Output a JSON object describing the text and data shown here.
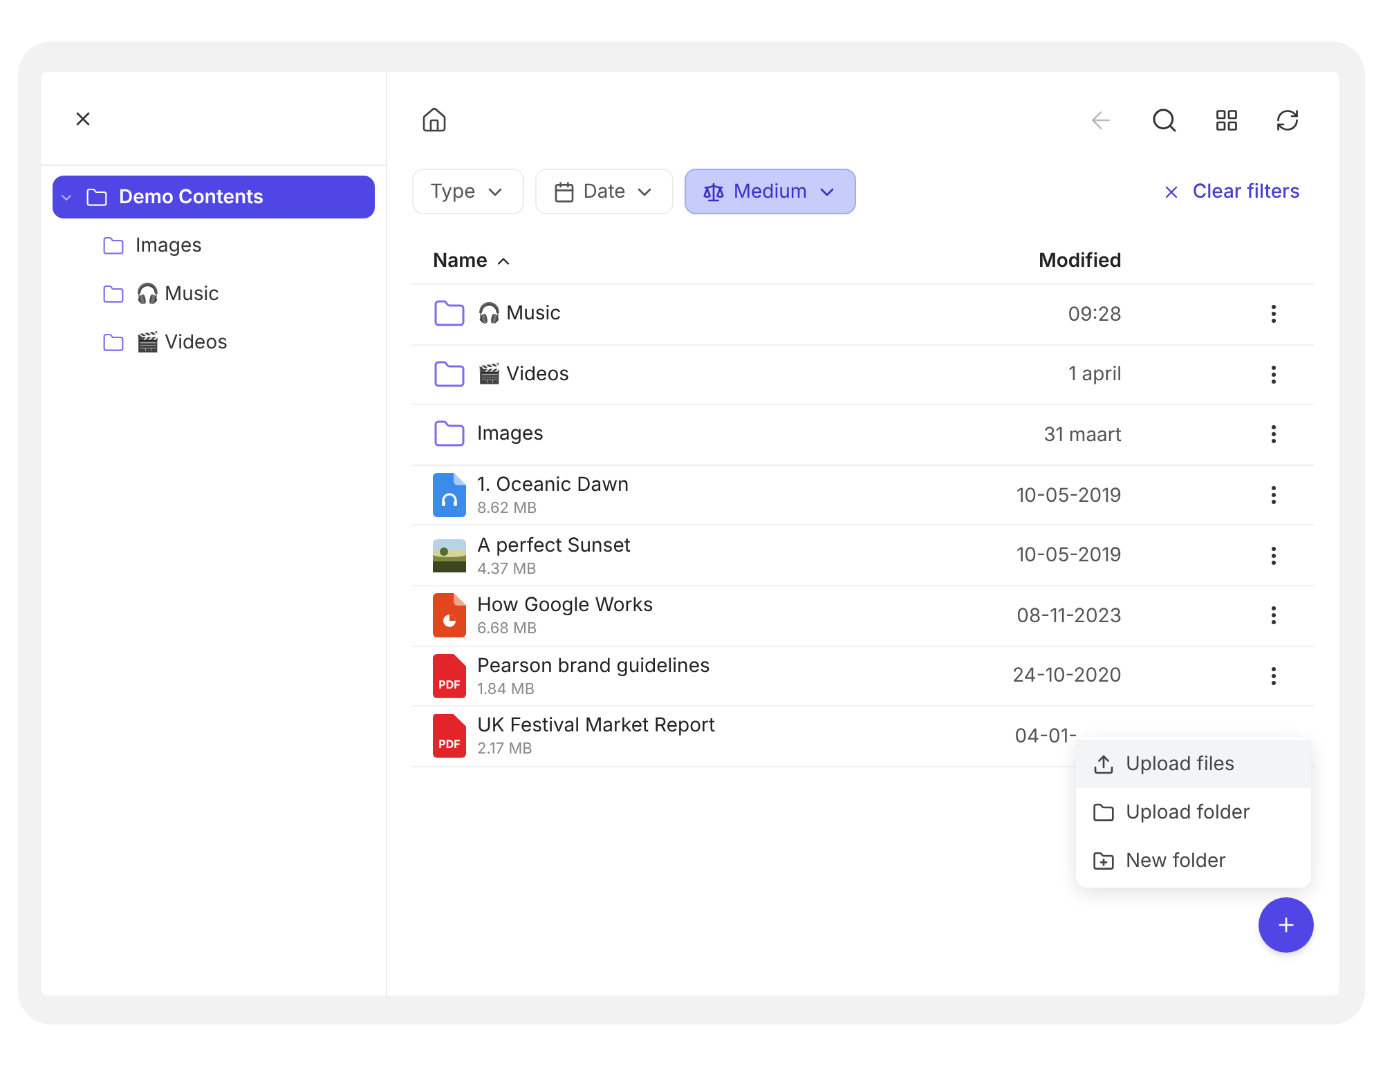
{
  "sidebar": {
    "tree": [
      {
        "label": "Demo Contents",
        "selected": true,
        "expanded": true,
        "children": [
          {
            "label": "Images",
            "selected": false
          },
          {
            "label": "🎧 Music",
            "selected": false
          },
          {
            "label": "🎬 Videos",
            "selected": false
          }
        ]
      }
    ]
  },
  "filters": [
    {
      "kind": "type",
      "label": "Type",
      "active": false
    },
    {
      "kind": "date",
      "label": "Date",
      "active": false
    },
    {
      "kind": "size",
      "label": "Medium",
      "active": true
    }
  ],
  "clear_filters": "Clear filters",
  "table": {
    "columns": [
      {
        "label": "Name",
        "sorted": true
      },
      {
        "label": "Modified",
        "sorted": false
      }
    ],
    "rows": [
      {
        "kind": "folder",
        "name": "🎧 Music",
        "modified": "09:28",
        "more_button": true
      },
      {
        "kind": "folder",
        "name": "🎬 Videos",
        "modified": "1 april",
        "more_button": true
      },
      {
        "kind": "folder",
        "name": "Images",
        "modified": "31 maart",
        "more_button": true
      },
      {
        "kind": "audio",
        "name": "1. Oceanic Dawn",
        "size": "8.62 MB",
        "modified": "10-05-2019",
        "more_button": true
      },
      {
        "name": "A perfect Sunset",
        "size": "4.37 MB",
        "modified": "10-05-2019",
        "more_button": true
      },
      {
        "kind": "slides",
        "name": "How Google Works",
        "size": "6.68 MB",
        "modified": "08-11-2023",
        "more_button": true
      },
      {
        "kind": "pdf",
        "badge": "PDF",
        "name": "Pearson brand guidelines",
        "size": "1.84 MB",
        "modified": "24-10-2020",
        "more_button": true
      },
      {
        "kind": "pdf",
        "badge": "PDF",
        "name": "UK Festival Market Report",
        "size": "2.17 MB",
        "modified": "04-01-",
        "more_button": false
      }
    ]
  },
  "add_menu": [
    {
      "kind": "upload",
      "label": "Upload files",
      "selected": true
    },
    {
      "kind": "folder",
      "label": "Upload folder",
      "selected": false
    },
    {
      "kind": "new",
      "label": "New folder",
      "selected": false
    }
  ]
}
